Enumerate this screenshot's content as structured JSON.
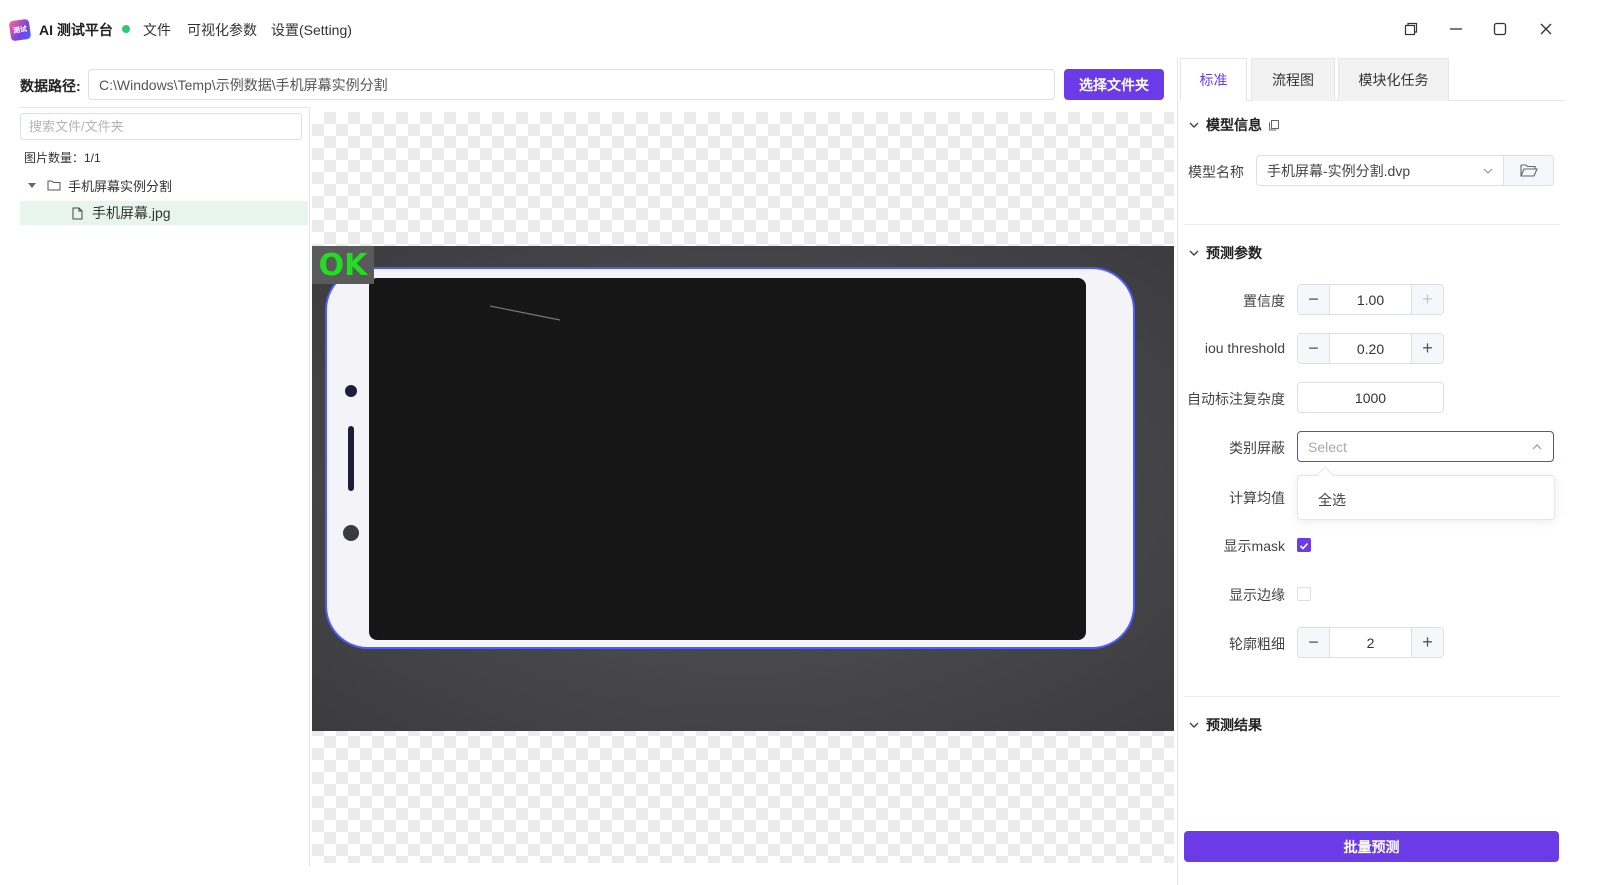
{
  "app": {
    "title": "AI 测试平台",
    "logo_text": "测试",
    "status_color": "#2ecc71",
    "accent_color": "#6b3be8"
  },
  "menu": {
    "items": [
      "文件",
      "可视化参数",
      "设置(Setting)"
    ]
  },
  "path_bar": {
    "label": "数据路径:",
    "value": "C:\\Windows\\Temp\\示例数据\\手机屏幕实例分割",
    "select_button": "选择文件夹"
  },
  "file_panel": {
    "search_placeholder": "搜索文件/文件夹",
    "count_text": "图片数量：1/1",
    "folder_name": "手机屏幕实例分割",
    "file_name": "手机屏幕.jpg"
  },
  "viewer": {
    "result_label": "OK",
    "result_color": "#1ee01e"
  },
  "tabs": [
    "标准",
    "流程图",
    "模块化任务"
  ],
  "model_info": {
    "title": "模型信息",
    "model_name_label": "模型名称",
    "model_name_value": "手机屏幕-实例分割.dvp"
  },
  "predict_params": {
    "title": "预测参数",
    "confidence_label": "置信度",
    "confidence_value": "1.00",
    "iou_label": "iou threshold",
    "iou_value": "0.20",
    "auto_label_label": "自动标注复杂度",
    "auto_label_value": "1000",
    "class_mask_label": "类别屏蔽",
    "class_mask_placeholder": "Select",
    "dropdown_option": "全选",
    "calc_mean_label": "计算均值",
    "show_mask_label": "显示mask",
    "show_mask_checked": true,
    "show_edge_label": "显示边缘",
    "show_edge_checked": false,
    "contour_label": "轮廓粗细",
    "contour_value": "2"
  },
  "predict_result": {
    "title": "预测结果"
  },
  "batch_button": "批量预测"
}
